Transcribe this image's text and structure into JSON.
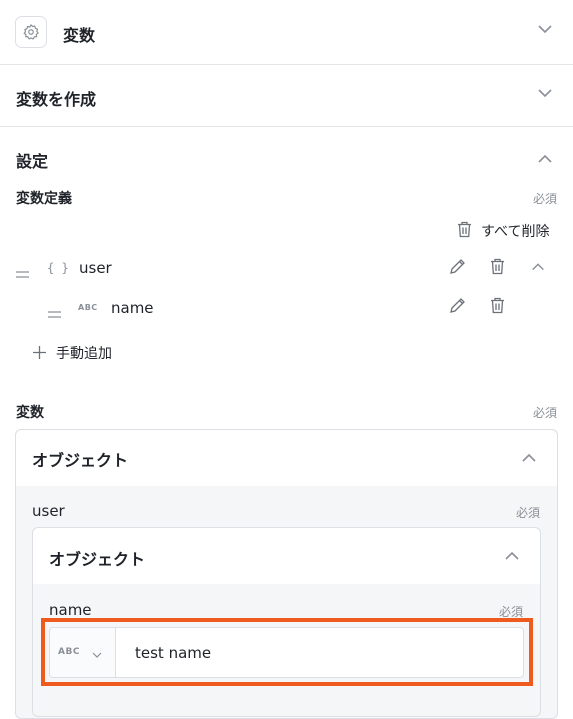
{
  "sections": {
    "variables_title": "変数",
    "create_variable_title": "変数を作成",
    "settings_title": "設定"
  },
  "definition": {
    "label": "変数定義",
    "required": "必須",
    "delete_all": "すべて削除",
    "rows": [
      {
        "type_glyph": "{ }",
        "name": "user"
      },
      {
        "type_glyph": "ABC",
        "name": "name"
      }
    ],
    "add_manual": "手動追加"
  },
  "values": {
    "label": "変数",
    "required": "必須",
    "outer_card_title": "オブジェクト",
    "user_label": "user",
    "user_required": "必須",
    "inner_card_title": "オブジェクト",
    "name_label": "name",
    "name_required": "必須",
    "type_selector": "ABC",
    "name_value": "test name"
  },
  "colors": {
    "highlight": "#ef5a1f"
  }
}
